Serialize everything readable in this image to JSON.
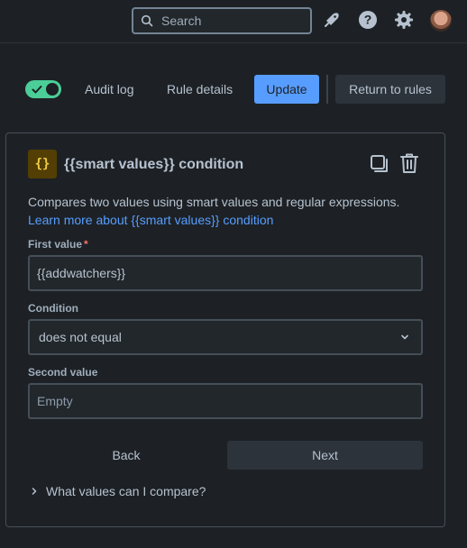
{
  "topbar": {
    "search_placeholder": "Search",
    "icons": [
      "notifications-icon",
      "help-icon",
      "settings-icon",
      "avatar"
    ]
  },
  "header": {
    "toggle_on": true,
    "audit_log": "Audit log",
    "rule_details": "Rule details",
    "update": "Update",
    "return_to_rules": "Return to rules"
  },
  "panel": {
    "icon_glyph": "{}",
    "title": "{{smart values}} condition",
    "description": "Compares two values using smart values and regular expressions.",
    "learn_more": "Learn more about {{smart values}} condition",
    "first_value_label": "First value",
    "required_marker": "*",
    "first_value": "{{addwatchers}}",
    "condition_label": "Condition",
    "condition_value": "does not equal",
    "second_value_label": "Second value",
    "second_value_placeholder": "Empty",
    "back": "Back",
    "next": "Next",
    "expander": "What values can I compare?"
  },
  "colors": {
    "background": "#1d2125",
    "primary": "#579dff",
    "toggle": "#4bce97",
    "icon_accent": "#f5cd47"
  }
}
